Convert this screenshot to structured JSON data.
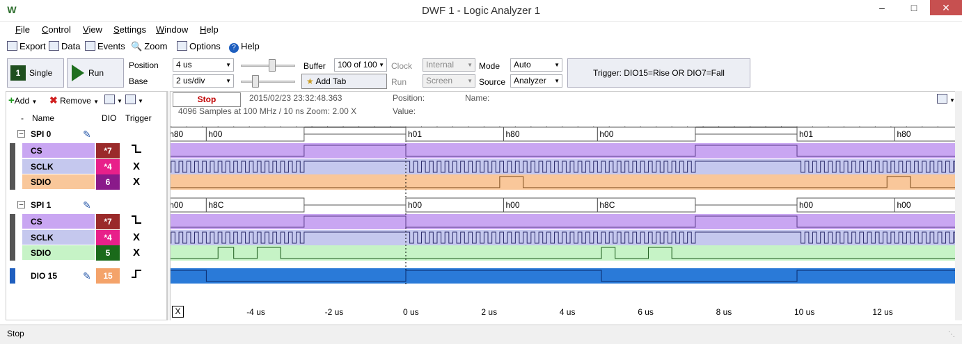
{
  "window": {
    "title": "DWF 1 - Logic Analyzer 1"
  },
  "menu": [
    "File",
    "Control",
    "View",
    "Settings",
    "Window",
    "Help"
  ],
  "toolbar": {
    "export": "Export",
    "data": "Data",
    "events": "Events",
    "zoom": "Zoom",
    "options": "Options",
    "help": "Help"
  },
  "controls": {
    "single": "Single",
    "run": "Run",
    "position_label": "Position",
    "position_value": "4 us",
    "base_label": "Base",
    "base_value": "2 us/div",
    "buffer_label": "Buffer",
    "buffer_value": "100 of 100",
    "add_tab": "Add Tab",
    "clock_label": "Clock",
    "clock_value": "Internal",
    "run_label": "Run",
    "run_value": "Screen",
    "mode_label": "Mode",
    "mode_value": "Auto",
    "source_label": "Source",
    "source_value": "Analyzer",
    "trigger_text": "Trigger: DIO15=Rise OR DIO7=Fall"
  },
  "channel_panel": {
    "add": "Add",
    "remove": "Remove",
    "headers": {
      "dash": "-",
      "name": "Name",
      "dio": "DIO",
      "trigger": "Trigger"
    },
    "rows": [
      {
        "name": "SPI 0",
        "kind": "group"
      },
      {
        "name": "CS",
        "dio": "*7",
        "trigger": "fall",
        "color": "#c9a6f2",
        "dio_color": "#9a2a2a"
      },
      {
        "name": "SCLK",
        "dio": "*4",
        "trigger": "X",
        "color": "#c5c8ee",
        "dio_color": "#e8208a"
      },
      {
        "name": "SDIO",
        "dio": "6",
        "trigger": "X",
        "color": "#f9c79a",
        "dio_color": "#8a1a8a"
      },
      {
        "name": "SPI 1",
        "kind": "group"
      },
      {
        "name": "CS",
        "dio": "*7",
        "trigger": "fall",
        "color": "#c9a6f2",
        "dio_color": "#9a2a2a"
      },
      {
        "name": "SCLK",
        "dio": "*4",
        "trigger": "X",
        "color": "#c5c8ee",
        "dio_color": "#e8208a"
      },
      {
        "name": "SDIO",
        "dio": "5",
        "trigger": "X",
        "color": "#c6f3c6",
        "dio_color": "#1a6a1a"
      },
      {
        "name": "DIO 15",
        "dio": "15",
        "trigger": "rise",
        "color": "#ffffff",
        "dio_color": "#f4a36a"
      }
    ]
  },
  "acquisition": {
    "stop": "Stop",
    "timestamp": "2015/02/23  23:32:48.363",
    "samples": "4096 Samples at 100 MHz / 10 ns Zoom: 2.00 X",
    "position": "Position:",
    "name": "Name:",
    "value": "Value:"
  },
  "bus_labels": {
    "spi0": [
      "h80",
      "h00",
      "h01",
      "h80",
      "h00",
      "h01",
      "h80"
    ],
    "spi1": [
      "h00",
      "h8C",
      "h00",
      "h00",
      "h8C",
      "h00",
      "h00"
    ]
  },
  "time_axis": [
    "-4 us",
    "-2 us",
    "0 us",
    "2 us",
    "4 us",
    "6 us",
    "8 us",
    "10 us",
    "12 us"
  ],
  "axis_button": "X",
  "status": "Stop"
}
